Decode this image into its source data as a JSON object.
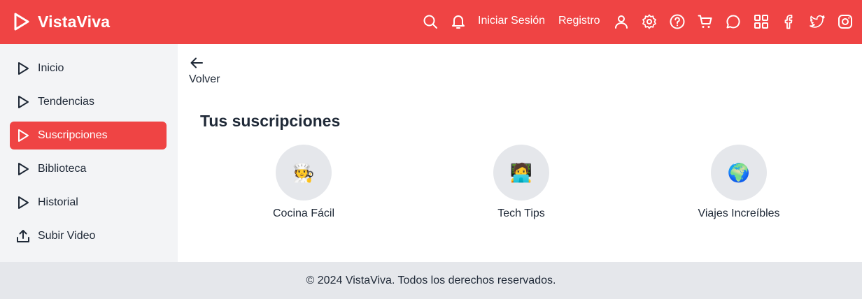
{
  "header": {
    "app_name": "VistaViva",
    "login_label": "Iniciar Sesión",
    "register_label": "Registro",
    "icons": [
      "search-icon",
      "bell-icon",
      "user-icon",
      "gear-icon",
      "help-icon",
      "cart-icon",
      "chat-icon",
      "grid-icon",
      "facebook-icon",
      "twitter-icon",
      "instagram-icon"
    ]
  },
  "sidebar": {
    "items": [
      {
        "label": "Inicio",
        "icon": "play-icon",
        "active": false
      },
      {
        "label": "Tendencias",
        "icon": "play-icon",
        "active": false
      },
      {
        "label": "Suscripciones",
        "icon": "play-icon",
        "active": true
      },
      {
        "label": "Biblioteca",
        "icon": "play-icon",
        "active": false
      },
      {
        "label": "Historial",
        "icon": "play-icon",
        "active": false
      },
      {
        "label": "Subir Video",
        "icon": "upload-icon",
        "active": false
      }
    ]
  },
  "main": {
    "back_label": "Volver",
    "title": "Tus suscripciones",
    "subscriptions": [
      {
        "name": "Cocina Fácil",
        "emoji": "🧑‍🍳"
      },
      {
        "name": "Tech Tips",
        "emoji": "🧑‍💻"
      },
      {
        "name": "Viajes Increíbles",
        "emoji": "🌍"
      }
    ]
  },
  "footer": {
    "text": "© 2024 VistaViva. Todos los derechos reservados."
  },
  "colors": {
    "brand": "#ef4444",
    "sidebar_bg": "#f3f4f6",
    "footer_bg": "#e5e7eb",
    "avatar_bg": "#e5e7eb",
    "text": "#1f2937"
  }
}
